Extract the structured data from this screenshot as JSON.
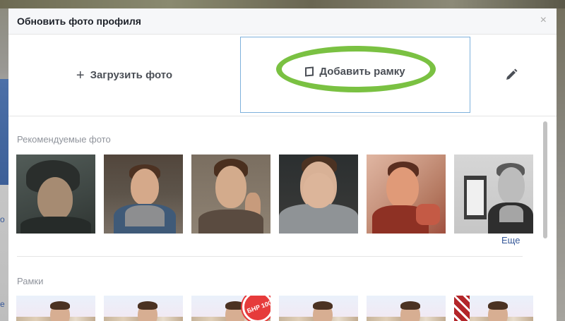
{
  "dialog": {
    "title": "Обновить фото профиля",
    "close_icon": "×"
  },
  "actions": {
    "upload_label": "Загрузить фото",
    "add_frame_label": "Добавить рамку",
    "edit_icon": "pencil-icon"
  },
  "recommended": {
    "label": "Рекомендуемые фото",
    "more_label": "Еще",
    "count": 6
  },
  "frames": {
    "label": "Рамки",
    "count": 6,
    "frame3_badge": "БНР 100"
  },
  "background": {
    "link_fragment_1": "о",
    "link_fragment_2": "е"
  },
  "colors": {
    "highlight_ellipse": "#7ac142",
    "selected_border": "#7eb1dc",
    "link": "#365899"
  }
}
